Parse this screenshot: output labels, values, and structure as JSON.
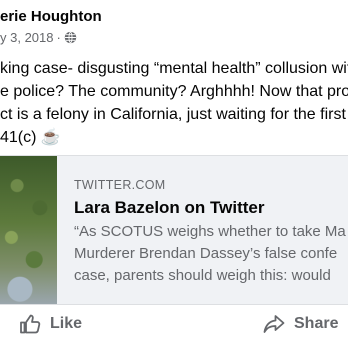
{
  "post": {
    "author": "erie Houghton",
    "date": "y 3, 2018",
    "separator": "·",
    "text_lines": [
      "king case- disgusting “mental health” collusion wit",
      "e police? The community? Arghhhh! Now that pros",
      "ct is a felony in California, just waiting for the first c",
      "41(c) ☕"
    ]
  },
  "link_card": {
    "domain": "TWITTER.COM",
    "title": "Lara Bazelon on Twitter",
    "desc_lines": [
      "“As SCOTUS weighs whether to take Ma",
      "Murderer Brendan Dassey’s false confe",
      "case, parents should weigh this: would"
    ]
  },
  "actions": {
    "like_label": "Like",
    "share_label": "Share"
  }
}
